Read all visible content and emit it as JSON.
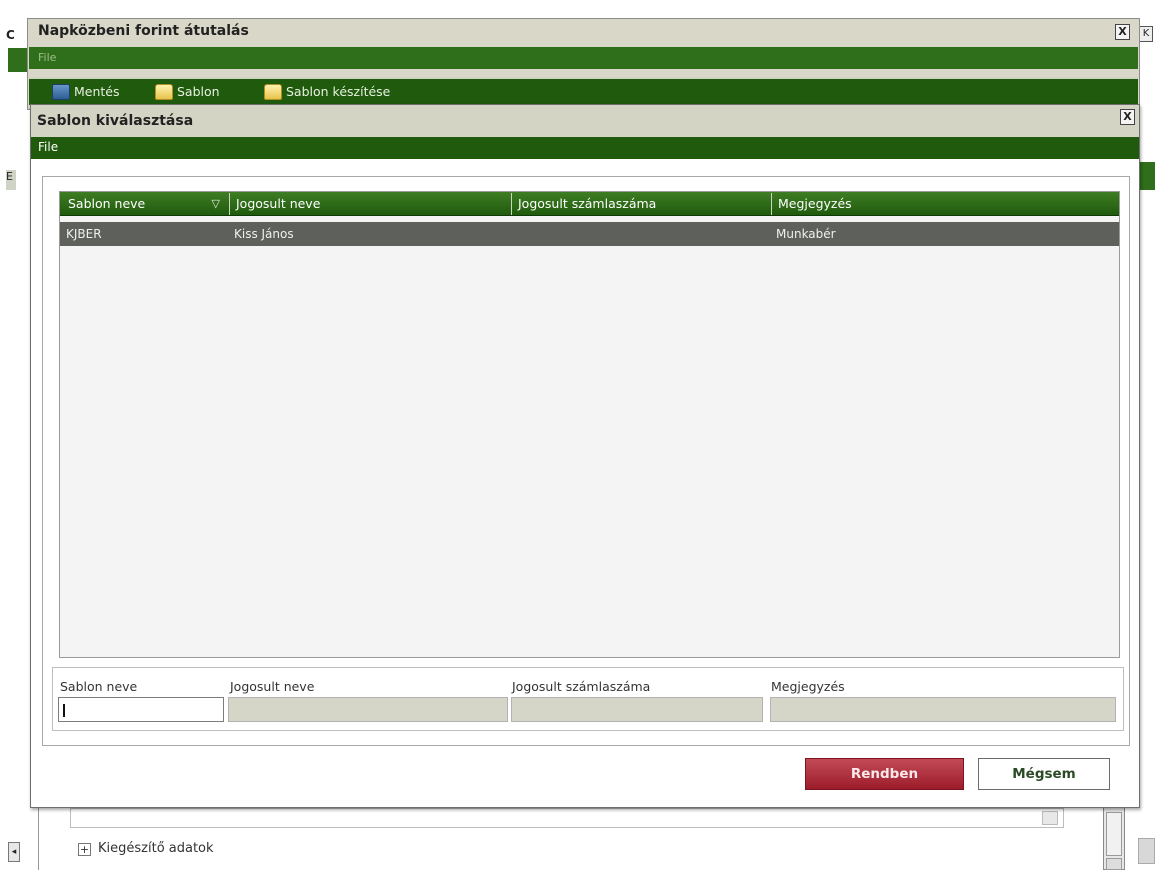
{
  "background_window": {
    "edge_char_c": "C",
    "edge_char_e": "E",
    "close_label": "K",
    "expander_symbol": "+",
    "expander_label": "Kiegészítő adatok"
  },
  "transfer_dialog": {
    "title": "Napközbeni forint átutalás",
    "close_label": "X",
    "menu": {
      "file_label": "File"
    },
    "toolbar": {
      "save_label": "Mentés",
      "template_label": "Sablon",
      "create_template_label": "Sablon készítése"
    }
  },
  "template_dialog": {
    "title": "Sablon kiválasztása",
    "close_label": "X",
    "menu": {
      "file_label": "File"
    },
    "grid": {
      "columns": [
        "Sablon neve",
        "Jogosult neve",
        "Jogosult számlaszáma",
        "Megjegyzés"
      ],
      "sort_indicator": "▽",
      "rows": [
        {
          "template_name": "KJBER",
          "beneficiary_name": "Kiss János",
          "account_number": "",
          "note": "Munkabér"
        }
      ]
    },
    "filters": {
      "labels": [
        "Sablon neve",
        "Jogosult neve",
        "Jogosult számlaszáma",
        "Megjegyzés"
      ],
      "values": [
        "",
        "",
        "",
        ""
      ]
    },
    "buttons": {
      "ok_label": "Rendben",
      "cancel_label": "Mégsem"
    }
  },
  "colors": {
    "dark_green": "#1f5a0d",
    "menu_green": "#2f6e1a",
    "selected_row": "#5d605b",
    "ok_button": "#9d1c2b",
    "dialog_gray": "#d4d4c4"
  }
}
